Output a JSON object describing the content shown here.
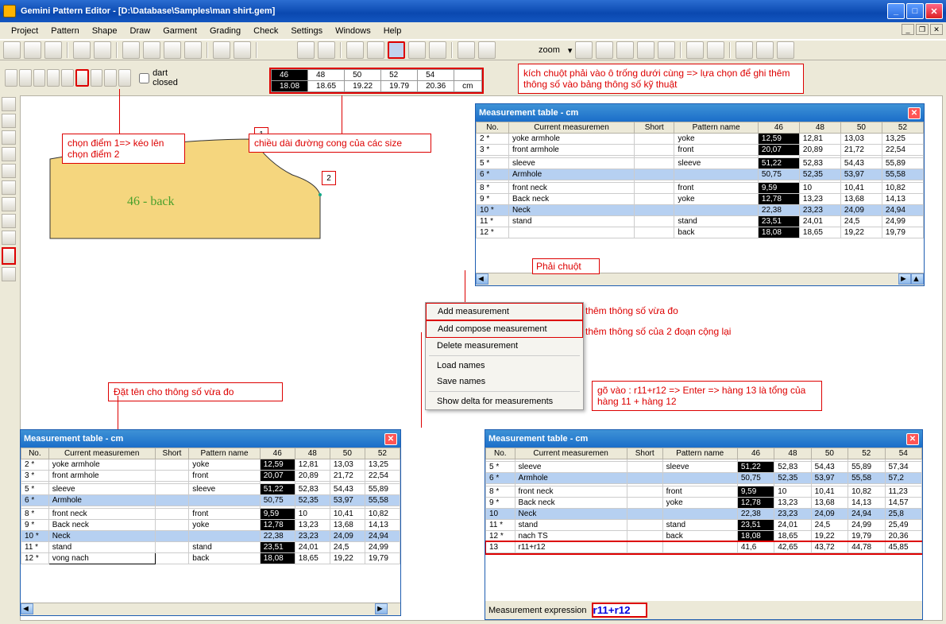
{
  "title": "Gemini Pattern Editor - [D:\\Database\\Samples\\man shirt.gem]",
  "menu": [
    "Project",
    "Pattern",
    "Shape",
    "Draw",
    "Garment",
    "Grading",
    "Check",
    "Settings",
    "Windows",
    "Help"
  ],
  "zoom_label": "zoom",
  "dart_label": "dart closed",
  "size_grid": {
    "headers": [
      "46",
      "48",
      "50",
      "52",
      "54",
      ""
    ],
    "row": [
      "18.08",
      "18.65",
      "19.22",
      "19.79",
      "20.36",
      "cm"
    ]
  },
  "annot": {
    "a1": "chọn điểm 1=> kéo lên chọn điểm 2",
    "a2": "chiều dài đường cong của các size",
    "a3": "kích chuột phải vào ô trống dưới cùng => lựa chọn để ghi thêm thông số vào bảng thông số kỹ thuật",
    "a4": "Phải chuột",
    "a5": "thêm thông số vừa đo",
    "a6": "thêm thông số của 2 đoạn cộng lại",
    "a7": "Đặt tên cho thông số vừa đo",
    "a8": "gõ vào : r11+r12 => Enter => hàng 13 là tổng của hàng 11 + hàng 12"
  },
  "ctx": {
    "items": [
      "Add measurement",
      "Add compose measurement",
      "Delete measurement",
      "Load names",
      "Save names",
      "Show delta for measurements"
    ]
  },
  "pattern_label": "46 - back",
  "pt1": "1",
  "pt2": "2",
  "mtable": {
    "title": "Measurement table - cm",
    "cols": [
      "No.",
      "Current measuremen",
      "Short",
      "Pattern name",
      "46",
      "48",
      "50",
      "52"
    ],
    "rows": [
      {
        "no": "2 *",
        "cm": "yoke armhole",
        "sh": "",
        "pn": "yoke",
        "v": [
          "12,59",
          "12,81",
          "13,03",
          "13,25"
        ],
        "bk": 0
      },
      {
        "no": "3 *",
        "cm": "front armhole",
        "sh": "",
        "pn": "front",
        "v": [
          "20,07",
          "20,89",
          "21,72",
          "22,54"
        ],
        "bk": 0
      },
      {
        "no": "",
        "cm": "",
        "sh": "",
        "pn": "",
        "v": [
          "",
          "",
          "",
          ""
        ]
      },
      {
        "no": "5 *",
        "cm": "sleeve",
        "sh": "",
        "pn": "sleeve",
        "v": [
          "51,22",
          "52,83",
          "54,43",
          "55,89"
        ],
        "bk": 0
      },
      {
        "no": "6 *",
        "cm": "Armhole",
        "sh": "",
        "pn": "",
        "v": [
          "50,75",
          "52,35",
          "53,97",
          "55,58"
        ],
        "sel": true
      },
      {
        "no": "",
        "cm": "",
        "sh": "",
        "pn": "",
        "v": [
          "",
          "",
          "",
          ""
        ]
      },
      {
        "no": "8 *",
        "cm": "front neck",
        "sh": "",
        "pn": "front",
        "v": [
          "9,59",
          "10",
          "10,41",
          "10,82"
        ],
        "bk": 0
      },
      {
        "no": "9 *",
        "cm": "Back neck",
        "sh": "",
        "pn": "yoke",
        "v": [
          "12,78",
          "13,23",
          "13,68",
          "14,13"
        ],
        "bk": 0
      },
      {
        "no": "10 *",
        "cm": "Neck",
        "sh": "",
        "pn": "",
        "v": [
          "22,38",
          "23,23",
          "24,09",
          "24,94"
        ],
        "sel": true
      },
      {
        "no": "11 *",
        "cm": "stand",
        "sh": "",
        "pn": "stand",
        "v": [
          "23,51",
          "24,01",
          "24,5",
          "24,99"
        ],
        "bk": 0
      },
      {
        "no": "12 *",
        "cm": "",
        "sh": "",
        "pn": "back",
        "v": [
          "18,08",
          "18,65",
          "19,22",
          "19,79"
        ],
        "bk": 0
      }
    ]
  },
  "mtable2": {
    "rows": [
      {
        "no": "2 *",
        "cm": "yoke armhole",
        "sh": "",
        "pn": "yoke",
        "v": [
          "12,59",
          "12,81",
          "13,03",
          "13,25"
        ],
        "bk": 0
      },
      {
        "no": "3 *",
        "cm": "front armhole",
        "sh": "",
        "pn": "front",
        "v": [
          "20,07",
          "20,89",
          "21,72",
          "22,54"
        ],
        "bk": 0
      },
      {
        "no": "",
        "cm": "",
        "sh": "",
        "pn": "",
        "v": [
          "",
          "",
          "",
          ""
        ]
      },
      {
        "no": "5 *",
        "cm": "sleeve",
        "sh": "",
        "pn": "sleeve",
        "v": [
          "51,22",
          "52,83",
          "54,43",
          "55,89"
        ],
        "bk": 0
      },
      {
        "no": "6 *",
        "cm": "Armhole",
        "sh": "",
        "pn": "",
        "v": [
          "50,75",
          "52,35",
          "53,97",
          "55,58"
        ],
        "sel": true
      },
      {
        "no": "",
        "cm": "",
        "sh": "",
        "pn": "",
        "v": [
          "",
          "",
          "",
          ""
        ]
      },
      {
        "no": "8 *",
        "cm": "front neck",
        "sh": "",
        "pn": "front",
        "v": [
          "9,59",
          "10",
          "10,41",
          "10,82"
        ],
        "bk": 0
      },
      {
        "no": "9 *",
        "cm": "Back neck",
        "sh": "",
        "pn": "yoke",
        "v": [
          "12,78",
          "13,23",
          "13,68",
          "14,13"
        ],
        "bk": 0
      },
      {
        "no": "10 *",
        "cm": "Neck",
        "sh": "",
        "pn": "",
        "v": [
          "22,38",
          "23,23",
          "24,09",
          "24,94"
        ],
        "sel": true
      },
      {
        "no": "11 *",
        "cm": "stand",
        "sh": "",
        "pn": "stand",
        "v": [
          "23,51",
          "24,01",
          "24,5",
          "24,99"
        ],
        "bk": 0
      },
      {
        "no": "12 *",
        "cm": "vong nach",
        "sh": "",
        "pn": "back",
        "v": [
          "18,08",
          "18,65",
          "19,22",
          "19,79"
        ],
        "bk": 0,
        "edit": true
      }
    ]
  },
  "mtable3": {
    "cols": [
      "No.",
      "Current measuremen",
      "Short",
      "Pattern name",
      "46",
      "48",
      "50",
      "52",
      "54"
    ],
    "rows": [
      {
        "no": "",
        "cm": "",
        "sh": "",
        "pn": "",
        "v": [
          "",
          "",
          "",
          "",
          ""
        ]
      },
      {
        "no": "5 *",
        "cm": "sleeve",
        "sh": "",
        "pn": "sleeve",
        "v": [
          "51,22",
          "52,83",
          "54,43",
          "55,89",
          "57,34"
        ],
        "bk": 0
      },
      {
        "no": "6 *",
        "cm": "Armhole",
        "sh": "",
        "pn": "",
        "v": [
          "50,75",
          "52,35",
          "53,97",
          "55,58",
          "57,2"
        ],
        "sel": true
      },
      {
        "no": "",
        "cm": "",
        "sh": "",
        "pn": "",
        "v": [
          "",
          "",
          "",
          "",
          ""
        ]
      },
      {
        "no": "8 *",
        "cm": "front neck",
        "sh": "",
        "pn": "front",
        "v": [
          "9,59",
          "10",
          "10,41",
          "10,82",
          "11,23"
        ],
        "bk": 0
      },
      {
        "no": "9 *",
        "cm": "Back neck",
        "sh": "",
        "pn": "yoke",
        "v": [
          "12,78",
          "13,23",
          "13,68",
          "14,13",
          "14,57"
        ],
        "bk": 0
      },
      {
        "no": "10",
        "cm": "Neck",
        "sh": "",
        "pn": "",
        "v": [
          "22,38",
          "23,23",
          "24,09",
          "24,94",
          "25,8"
        ],
        "sel": true
      },
      {
        "no": "11 *",
        "cm": "stand",
        "sh": "",
        "pn": "stand",
        "v": [
          "23,51",
          "24,01",
          "24,5",
          "24,99",
          "25,49"
        ],
        "bk": 0
      },
      {
        "no": "12 *",
        "cm": "nach TS",
        "sh": "",
        "pn": "back",
        "v": [
          "18,08",
          "18,65",
          "19,22",
          "19,79",
          "20,36"
        ],
        "bk": 0
      },
      {
        "no": "13",
        "cm": "r11+r12",
        "sh": "",
        "pn": "",
        "v": [
          "41,6",
          "42,65",
          "43,72",
          "44,78",
          "45,85"
        ],
        "red": true
      }
    ]
  },
  "expr": {
    "label": "Measurement expression",
    "value": "r11+r12"
  }
}
